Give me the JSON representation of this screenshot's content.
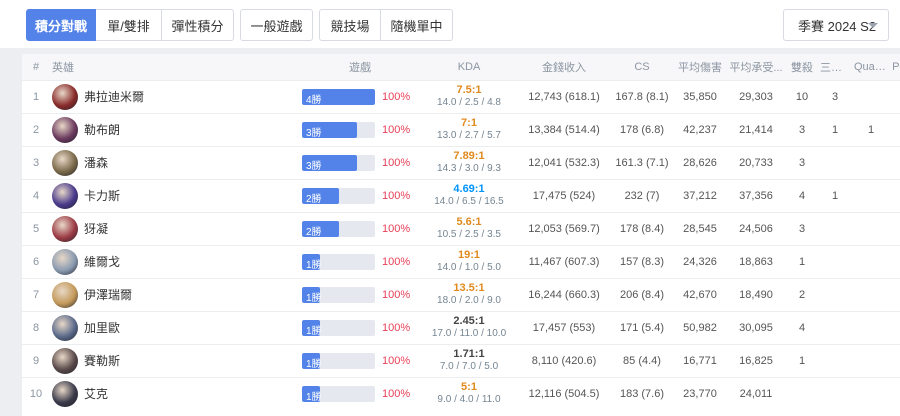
{
  "filters": {
    "queue_tabs": [
      {
        "label": "積分對戰",
        "active": true
      },
      {
        "label": "單/雙排",
        "active": false
      },
      {
        "label": "彈性積分",
        "active": false
      }
    ],
    "normal_label": "一般遊戲",
    "mode_tabs": [
      {
        "label": "競技場"
      },
      {
        "label": "隨機單中"
      }
    ],
    "season_label": "季賽 2024 S2"
  },
  "table": {
    "headers": [
      "#",
      "英雄",
      "遊戲",
      "KDA",
      "金錢收入",
      "CS",
      "平均傷害",
      "平均承受...",
      "雙殺",
      "三連殺",
      "Quadr...",
      "Pent..."
    ],
    "rows": [
      {
        "rank": "1",
        "champion": "弗拉迪米爾",
        "avatar_color": "#8a2b2b",
        "games": "4勝",
        "games_fraction": 1.0,
        "winrate": "100%",
        "kda_ratio": "7.5:1",
        "kda_color": "#e08a1e",
        "kda_detail": "14.0 / 2.5 / 4.8",
        "gold": "12,743 (618.1)",
        "cs": "167.8 (8.1)",
        "damage": "35,850",
        "taken": "29,303",
        "double": "10",
        "triple": "3",
        "quadra": "",
        "penta": ""
      },
      {
        "rank": "2",
        "champion": "勒布朗",
        "avatar_color": "#6b3a5e",
        "games": "3勝",
        "games_fraction": 0.75,
        "winrate": "100%",
        "kda_ratio": "7:1",
        "kda_color": "#e08a1e",
        "kda_detail": "13.0 / 2.7 / 5.7",
        "gold": "13,384 (514.4)",
        "cs": "178 (6.8)",
        "damage": "42,237",
        "taken": "21,414",
        "double": "3",
        "triple": "1",
        "quadra": "1",
        "penta": ""
      },
      {
        "rank": "3",
        "champion": "潘森",
        "avatar_color": "#7b6a4a",
        "games": "3勝",
        "games_fraction": 0.75,
        "winrate": "100%",
        "kda_ratio": "7.89:1",
        "kda_color": "#e08a1e",
        "kda_detail": "14.3 / 3.0 / 9.3",
        "gold": "12,041 (532.3)",
        "cs": "161.3 (7.1)",
        "damage": "28,626",
        "taken": "20,733",
        "double": "3",
        "triple": "",
        "quadra": "",
        "penta": ""
      },
      {
        "rank": "4",
        "champion": "卡力斯",
        "avatar_color": "#4a3a8c",
        "games": "2勝",
        "games_fraction": 0.5,
        "winrate": "100%",
        "kda_ratio": "4.69:1",
        "kda_color": "#0093ff",
        "kda_detail": "14.0 / 6.5 / 16.5",
        "gold": "17,475 (524)",
        "cs": "232 (7)",
        "damage": "37,212",
        "taken": "37,356",
        "double": "4",
        "triple": "1",
        "quadra": "",
        "penta": ""
      },
      {
        "rank": "5",
        "champion": "犽凝",
        "avatar_color": "#9c3b45",
        "games": "2勝",
        "games_fraction": 0.5,
        "winrate": "100%",
        "kda_ratio": "5.6:1",
        "kda_color": "#e08a1e",
        "kda_detail": "10.5 / 2.5 / 3.5",
        "gold": "12,053 (569.7)",
        "cs": "178 (8.4)",
        "damage": "28,545",
        "taken": "24,506",
        "double": "3",
        "triple": "",
        "quadra": "",
        "penta": ""
      },
      {
        "rank": "6",
        "champion": "維爾戈",
        "avatar_color": "#8a9bb0",
        "games": "1勝",
        "games_fraction": 0.25,
        "winrate": "100%",
        "kda_ratio": "19:1",
        "kda_color": "#e08a1e",
        "kda_detail": "14.0 / 1.0 / 5.0",
        "gold": "11,467 (607.3)",
        "cs": "157 (8.3)",
        "damage": "24,326",
        "taken": "18,863",
        "double": "1",
        "triple": "",
        "quadra": "",
        "penta": ""
      },
      {
        "rank": "7",
        "champion": "伊澤瑞爾",
        "avatar_color": "#c49a5a",
        "games": "1勝",
        "games_fraction": 0.25,
        "winrate": "100%",
        "kda_ratio": "13.5:1",
        "kda_color": "#e08a1e",
        "kda_detail": "18.0 / 2.0 / 9.0",
        "gold": "16,244 (660.3)",
        "cs": "206 (8.4)",
        "damage": "42,670",
        "taken": "18,490",
        "double": "2",
        "triple": "",
        "quadra": "",
        "penta": ""
      },
      {
        "rank": "8",
        "champion": "加里歐",
        "avatar_color": "#5a6a8a",
        "games": "1勝",
        "games_fraction": 0.25,
        "winrate": "100%",
        "kda_ratio": "2.45:1",
        "kda_color": "#444444",
        "kda_detail": "17.0 / 11.0 / 10.0",
        "gold": "17,457 (553)",
        "cs": "171 (5.4)",
        "damage": "50,982",
        "taken": "30,095",
        "double": "4",
        "triple": "",
        "quadra": "",
        "penta": ""
      },
      {
        "rank": "9",
        "champion": "賽勒斯",
        "avatar_color": "#5a4a4a",
        "games": "1勝",
        "games_fraction": 0.25,
        "winrate": "100%",
        "kda_ratio": "1.71:1",
        "kda_color": "#444444",
        "kda_detail": "7.0 / 7.0 / 5.0",
        "gold": "8,110 (420.6)",
        "cs": "85 (4.4)",
        "damage": "16,771",
        "taken": "16,825",
        "double": "1",
        "triple": "",
        "quadra": "",
        "penta": ""
      },
      {
        "rank": "10",
        "champion": "艾克",
        "avatar_color": "#3a3a4a",
        "games": "1勝",
        "games_fraction": 0.25,
        "winrate": "100%",
        "kda_ratio": "5:1",
        "kda_color": "#e08a1e",
        "kda_detail": "9.0 / 4.0 / 11.0",
        "gold": "12,116 (504.5)",
        "cs": "183 (7.6)",
        "damage": "23,770",
        "taken": "24,011",
        "double": "",
        "triple": "",
        "quadra": "",
        "penta": ""
      }
    ]
  }
}
